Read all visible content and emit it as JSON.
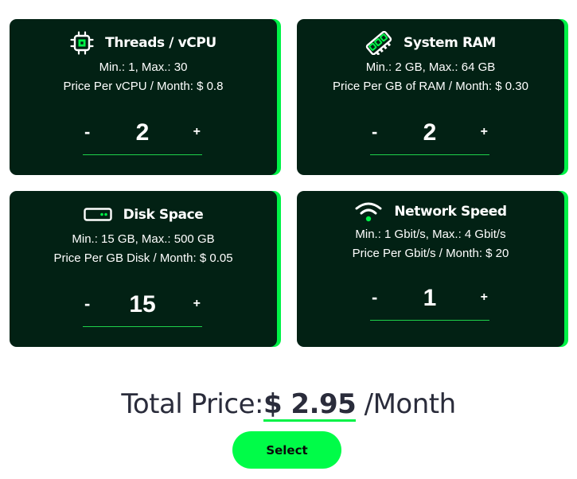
{
  "colors": {
    "card_bg": "#022114",
    "accent": "#00f247",
    "button_bg": "#00fc48",
    "total_text": "#2a2c3b"
  },
  "cards": [
    {
      "icon": "cpu-chip-icon",
      "title": "Threads / vCPU",
      "range": "Min.: 1, Max.: 30",
      "price": "Price Per vCPU / Month: $ 0.8",
      "minus": "-",
      "value": "2",
      "plus": "+"
    },
    {
      "icon": "ram-module-icon",
      "title": "System RAM",
      "range": "Min.: 2 GB, Max.: 64 GB",
      "price": "Price Per GB of RAM / Month: $ 0.30",
      "minus": "-",
      "value": "2",
      "plus": "+"
    },
    {
      "icon": "hard-disk-icon",
      "title": "Disk Space",
      "range": "Min.: 15 GB, Max.: 500 GB",
      "price": "Price Per GB Disk / Month: $ 0.05",
      "minus": "-",
      "value": "15",
      "plus": "+"
    },
    {
      "icon": "wifi-icon",
      "title": "Network Speed",
      "range": "Min.: 1 Gbit/s, Max.: 4 Gbit/s",
      "price": "Price Per Gbit/s / Month: $ 20",
      "minus": "-",
      "value": "1",
      "plus": "+"
    }
  ],
  "total": {
    "label": "Total Price:",
    "amount": "$ 2.95",
    "unit": "/Month"
  },
  "select_button": "Select"
}
